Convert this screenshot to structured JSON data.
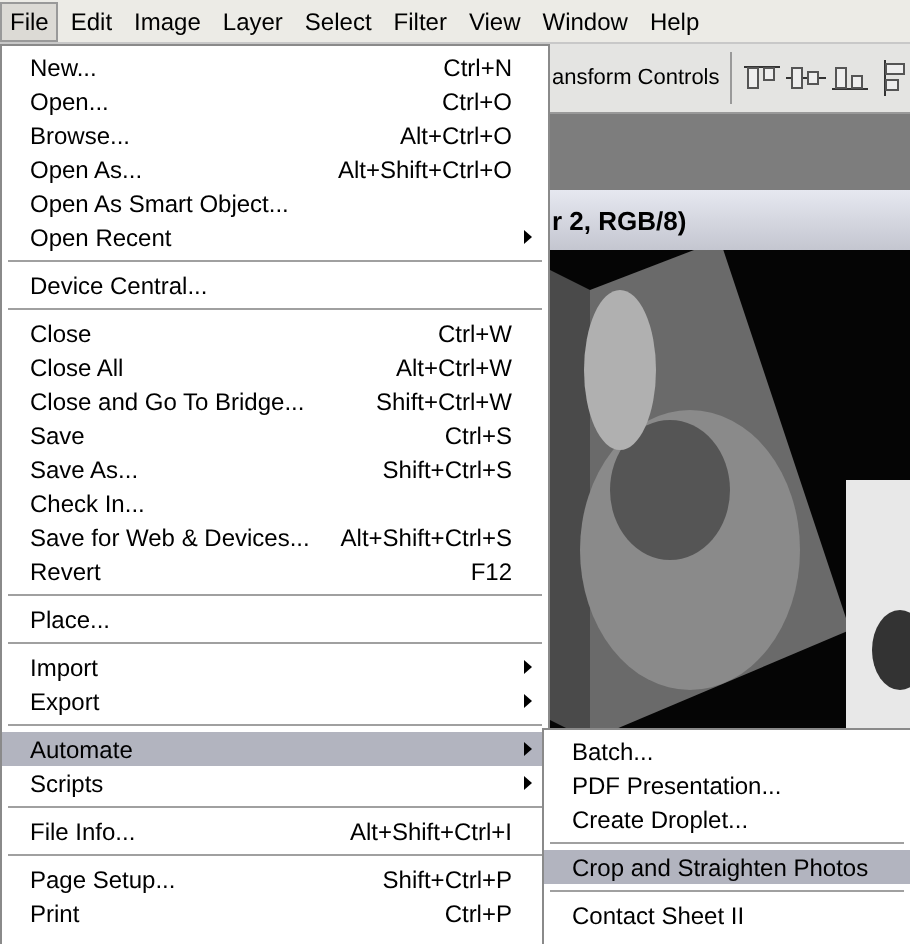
{
  "menu_bar": [
    {
      "label": "File",
      "selected": true
    },
    {
      "label": "Edit",
      "selected": false
    },
    {
      "label": "Image",
      "selected": false
    },
    {
      "label": "Layer",
      "selected": false
    },
    {
      "label": "Select",
      "selected": false
    },
    {
      "label": "Filter",
      "selected": false
    },
    {
      "label": "View",
      "selected": false
    },
    {
      "label": "Window",
      "selected": false
    },
    {
      "label": "Help",
      "selected": false
    }
  ],
  "options_bar": {
    "label": "ansform Controls"
  },
  "document": {
    "title": "r 2, RGB/8)"
  },
  "file_menu": {
    "sections": [
      [
        {
          "label": "New...",
          "shortcut": "Ctrl+N",
          "has_submenu": false,
          "selected": false
        },
        {
          "label": "Open...",
          "shortcut": "Ctrl+O",
          "has_submenu": false,
          "selected": false
        },
        {
          "label": "Browse...",
          "shortcut": "Alt+Ctrl+O",
          "has_submenu": false,
          "selected": false
        },
        {
          "label": "Open As...",
          "shortcut": "Alt+Shift+Ctrl+O",
          "has_submenu": false,
          "selected": false
        },
        {
          "label": "Open As Smart Object...",
          "has_submenu": false,
          "selected": false
        },
        {
          "label": "Open Recent",
          "has_submenu": true,
          "selected": false
        }
      ],
      [
        {
          "label": "Device Central...",
          "has_submenu": false,
          "selected": false
        }
      ],
      [
        {
          "label": "Close",
          "shortcut": "Ctrl+W",
          "has_submenu": false,
          "selected": false
        },
        {
          "label": "Close All",
          "shortcut": "Alt+Ctrl+W",
          "has_submenu": false,
          "selected": false
        },
        {
          "label": "Close and Go To Bridge...",
          "shortcut": "Shift+Ctrl+W",
          "has_submenu": false,
          "selected": false
        },
        {
          "label": "Save",
          "shortcut": "Ctrl+S",
          "has_submenu": false,
          "selected": false
        },
        {
          "label": "Save As...",
          "shortcut": "Shift+Ctrl+S",
          "has_submenu": false,
          "selected": false
        },
        {
          "label": "Check In...",
          "has_submenu": false,
          "selected": false
        },
        {
          "label": "Save for Web & Devices...",
          "shortcut": "Alt+Shift+Ctrl+S",
          "has_submenu": false,
          "selected": false
        },
        {
          "label": "Revert",
          "shortcut": "F12",
          "has_submenu": false,
          "selected": false
        }
      ],
      [
        {
          "label": "Place...",
          "has_submenu": false,
          "selected": false
        }
      ],
      [
        {
          "label": "Import",
          "has_submenu": true,
          "selected": false
        },
        {
          "label": "Export",
          "has_submenu": true,
          "selected": false
        }
      ],
      [
        {
          "label": "Automate",
          "has_submenu": true,
          "selected": true
        },
        {
          "label": "Scripts",
          "has_submenu": true,
          "selected": false
        }
      ],
      [
        {
          "label": "File Info...",
          "shortcut": "Alt+Shift+Ctrl+I",
          "has_submenu": false,
          "selected": false
        }
      ],
      [
        {
          "label": "Page Setup...",
          "shortcut": "Shift+Ctrl+P",
          "has_submenu": false,
          "selected": false
        },
        {
          "label": "Print",
          "shortcut": "Ctrl+P",
          "has_submenu": false,
          "selected": false
        }
      ]
    ]
  },
  "automate_submenu": {
    "sections": [
      [
        {
          "label": "Batch...",
          "selected": false
        },
        {
          "label": "PDF Presentation...",
          "selected": false
        },
        {
          "label": "Create Droplet...",
          "selected": false
        }
      ],
      [
        {
          "label": "Crop and Straighten Photos",
          "selected": true
        }
      ],
      [
        {
          "label": "Contact Sheet II",
          "selected": false
        }
      ]
    ]
  }
}
